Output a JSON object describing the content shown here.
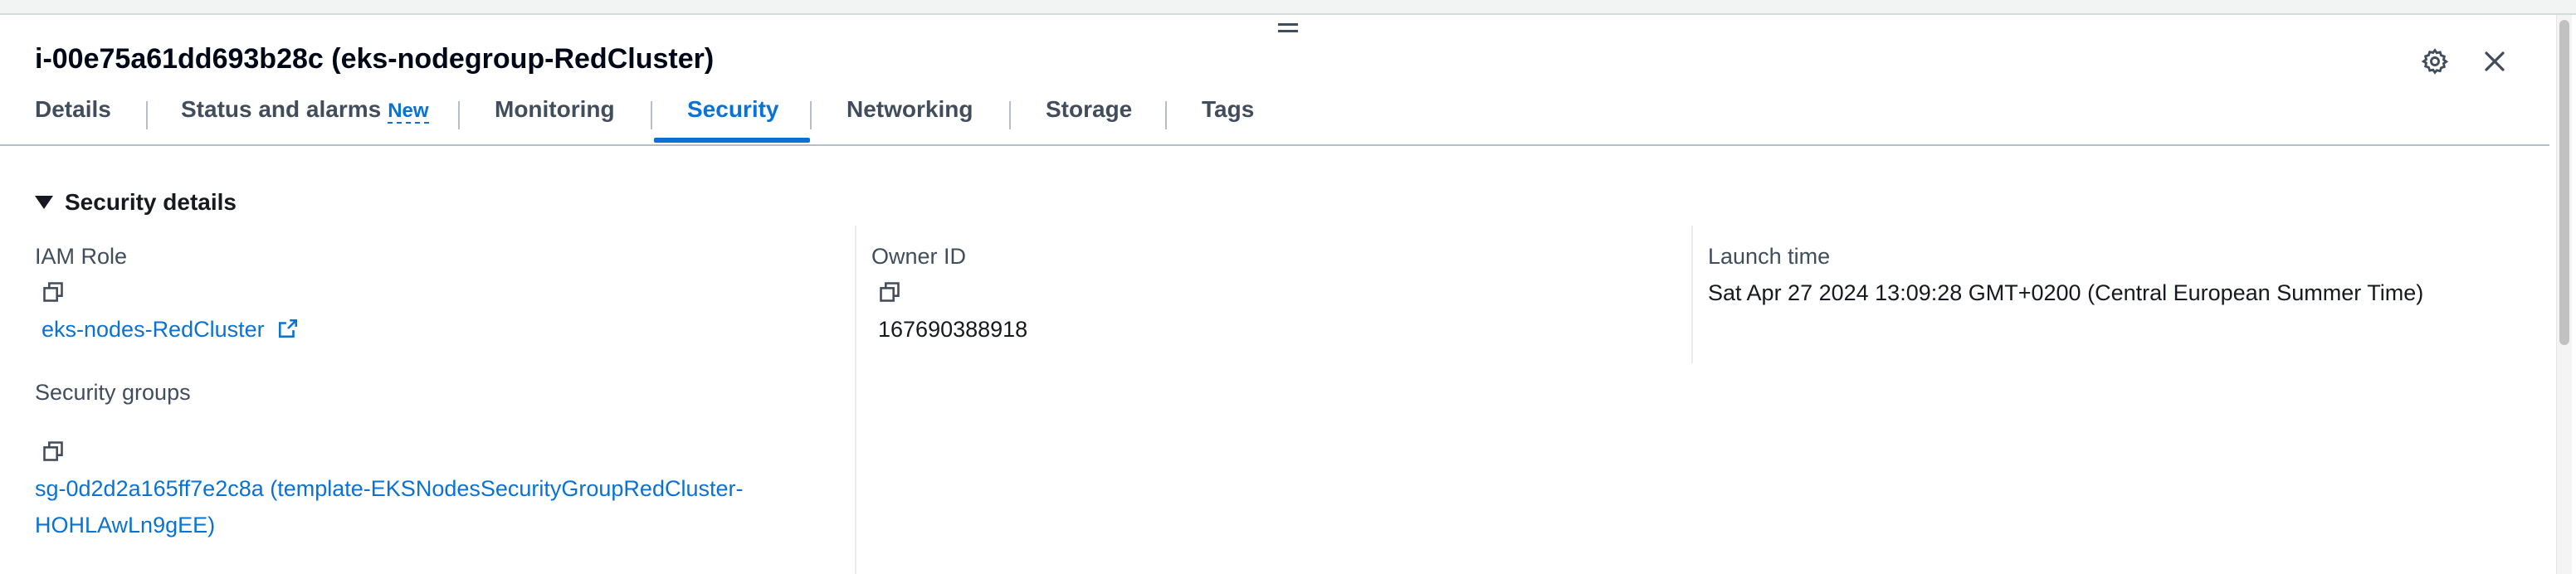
{
  "panel": {
    "title": "i-00e75a61dd693b28c (eks-nodegroup-RedCluster)"
  },
  "icons": {
    "drag": "drag-handle-icon",
    "settings": "gear-icon",
    "close": "close-icon",
    "copy": "copy-icon",
    "external": "external-link-icon",
    "caret": "caret-down-icon"
  },
  "tabs": [
    {
      "label": "Details"
    },
    {
      "label": "Status and alarms",
      "badge": "New"
    },
    {
      "label": "Monitoring"
    },
    {
      "label": "Security",
      "active": true
    },
    {
      "label": "Networking"
    },
    {
      "label": "Storage"
    },
    {
      "label": "Tags"
    }
  ],
  "section": {
    "title": "Security details",
    "iam_role": {
      "label": "IAM Role",
      "value": "eks-nodes-RedCluster"
    },
    "owner_id": {
      "label": "Owner ID",
      "value": "167690388918"
    },
    "launch_time": {
      "label": "Launch time",
      "value": "Sat Apr 27 2024 13:09:28 GMT+0200 (Central European Summer Time)"
    },
    "security_groups": {
      "label": "Security groups",
      "line1": "sg-0d2d2a165ff7e2c8a (template-EKSNodesSecurityGroupRedCluster-",
      "line2": "HOHLAwLn9gEE)"
    }
  },
  "colors": {
    "accent": "#0972d3",
    "text": "#16191f",
    "label": "#414d5c",
    "divider": "#b6bec9"
  }
}
